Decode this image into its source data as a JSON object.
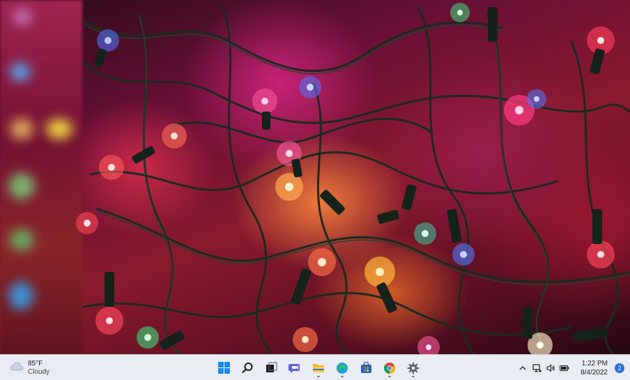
{
  "taskbar": {
    "weather": {
      "icon": "cloud-icon",
      "temperature": "85°F",
      "condition": "Cloudy"
    },
    "pinned_apps": [
      {
        "name": "start-button",
        "icon": "windows-logo-icon",
        "running": false
      },
      {
        "name": "search-button",
        "icon": "search-icon",
        "running": false
      },
      {
        "name": "task-view-button",
        "icon": "task-view-icon",
        "running": false
      },
      {
        "name": "chat-button",
        "icon": "teams-chat-icon",
        "running": false
      },
      {
        "name": "file-explorer-button",
        "icon": "folder-icon",
        "running": true
      },
      {
        "name": "edge-button",
        "icon": "edge-browser-icon",
        "running": true
      },
      {
        "name": "store-button",
        "icon": "store-bag-icon",
        "running": false
      },
      {
        "name": "chrome-button",
        "icon": "chrome-browser-icon",
        "running": true
      },
      {
        "name": "settings-button",
        "icon": "gear-icon",
        "running": true
      }
    ],
    "tray": {
      "icons": [
        "chevron-up-icon",
        "network-icon",
        "volume-icon",
        "battery-icon"
      ],
      "time": "1:22 PM",
      "date": "8/4/2022",
      "notification_count": "2"
    }
  },
  "colors": {
    "taskbar_bg": "#e9ecf2",
    "accent": "#2d6be0"
  }
}
